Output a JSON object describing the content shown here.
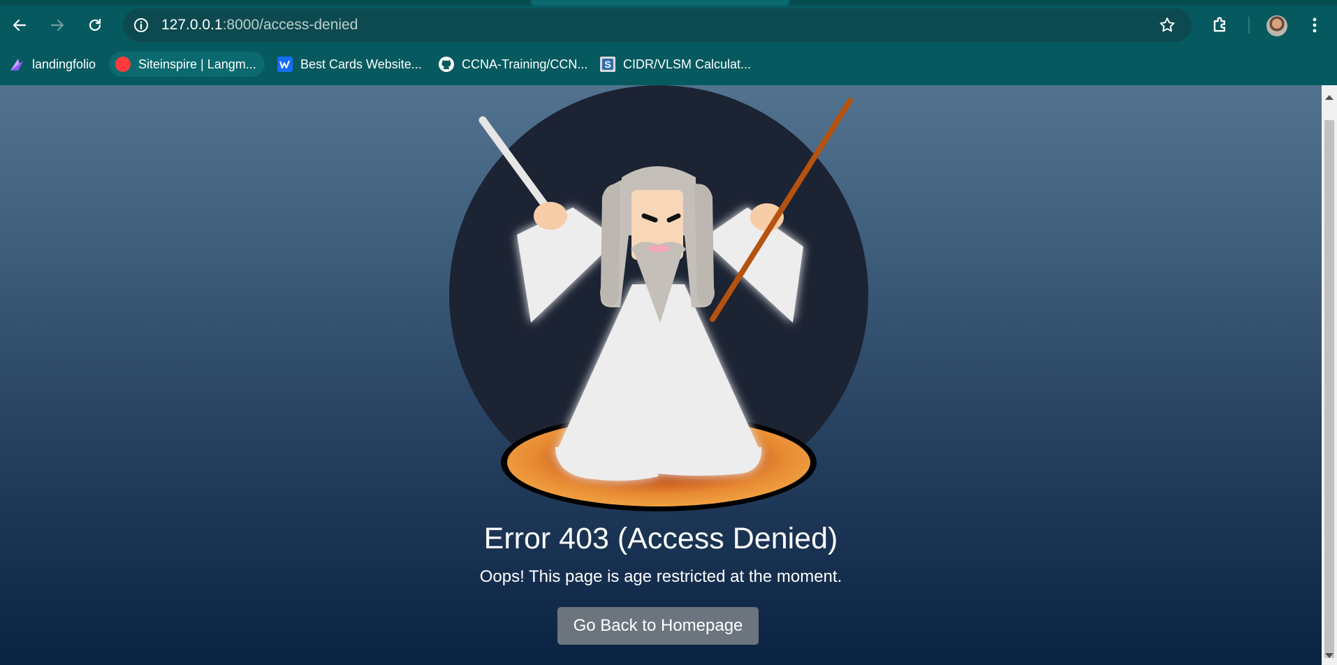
{
  "browser": {
    "url_host": "127.0.0.1",
    "url_path": ":8000/access-denied",
    "bookmarks": [
      {
        "label": "landingfolio",
        "icon": "landingfolio-icon"
      },
      {
        "label": "Siteinspire | Langm...",
        "icon": "siteinspire-icon"
      },
      {
        "label": "Best Cards Website...",
        "icon": "webflow-icon"
      },
      {
        "label": "CCNA-Training/CCN...",
        "icon": "github-icon"
      },
      {
        "label": "CIDR/VLSM Calculat...",
        "icon": "subnet-calculator-icon"
      }
    ]
  },
  "page": {
    "title": "Error 403 (Access Denied)",
    "message": "Oops! This page is age restricted at the moment.",
    "button_label": "Go Back to Homepage"
  },
  "colors": {
    "chrome": "#065a5f",
    "omnibox": "#0d4a4f",
    "circle": "#1c2333",
    "robe": "#ededed",
    "staff": "#b5520f",
    "button": "#6c757d"
  }
}
